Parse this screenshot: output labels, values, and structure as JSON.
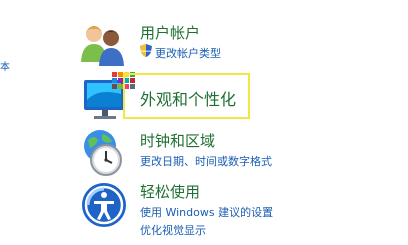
{
  "side": {
    "fragment": "本"
  },
  "user_accounts": {
    "title": "用户帐户",
    "link": "更改帐户类型"
  },
  "appearance": {
    "title": "外观和个性化"
  },
  "clock_region": {
    "title": "时钟和区域",
    "link1": "更改日期、时间或数字格式"
  },
  "ease_of_access": {
    "title": "轻松使用",
    "link1": "使用 Windows 建议的设置",
    "link2": "优化视觉显示"
  },
  "colors": {
    "title_green": "#1f6f32",
    "link_blue": "#1a5fb4",
    "highlight": "#efe845"
  }
}
